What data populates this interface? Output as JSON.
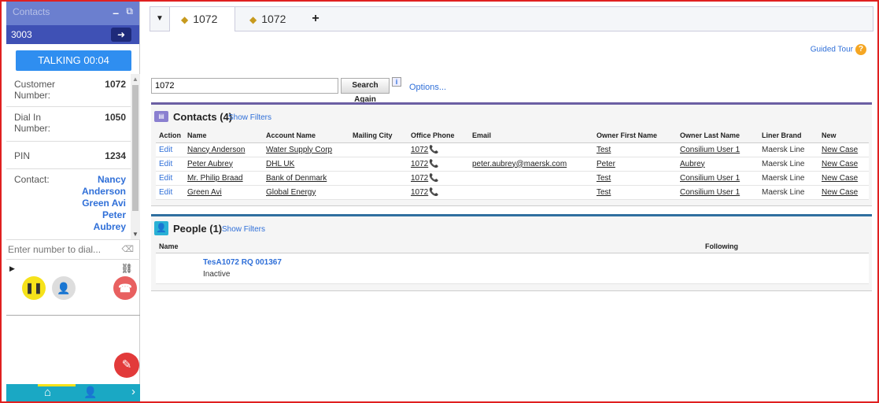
{
  "phone": {
    "title": "Contacts",
    "extension": "3003",
    "status": "TALKING 00:04",
    "info": [
      {
        "label": "Customer Number:",
        "value": "1072"
      },
      {
        "label": "Dial In Number:",
        "value": "1050"
      },
      {
        "label": "PIN",
        "value": "1234"
      }
    ],
    "contact_label": "Contact:",
    "contacts": [
      "Nancy",
      "Anderson",
      "Green Avi",
      "Peter",
      "Aubrey"
    ],
    "dial_placeholder": "Enter number to dial...",
    "colors": {
      "header": "#6b7fcf",
      "ext_bar": "#3f51b5",
      "talking": "#2f8ef0",
      "hold": "#f6e21a",
      "hangup": "#e86060",
      "edit": "#e23a3a",
      "bottom": "#1aa8c4"
    }
  },
  "tabs": [
    {
      "label": "1072",
      "active": true
    },
    {
      "label": "1072",
      "active": false
    }
  ],
  "guided_tour": "Guided Tour",
  "search": {
    "value": "1072",
    "button": "Search Again",
    "info": "i",
    "options": "Options..."
  },
  "contacts": {
    "title": "Contacts (4)",
    "show_filters": "Show Filters",
    "columns": [
      "Action",
      "Name",
      "Account Name",
      "Mailing City",
      "Office Phone",
      "Email",
      "Owner First Name",
      "Owner Last Name",
      "Liner Brand",
      "New"
    ],
    "rows": [
      {
        "action": "Edit",
        "name": "Nancy Anderson",
        "account": "Water Supply Corp",
        "city": "",
        "phone": "1072",
        "email": "",
        "owner_first": "Test",
        "owner_last": "Consilium User 1",
        "brand": "Maersk Line",
        "new": "New Case"
      },
      {
        "action": "Edit",
        "name": "Peter Aubrey",
        "account": "DHL UK",
        "city": "",
        "phone": "1072",
        "email": "peter.aubrey@maersk.com",
        "owner_first": "Peter",
        "owner_last": "Aubrey",
        "brand": "Maersk Line",
        "new": "New Case"
      },
      {
        "action": "Edit",
        "name": "Mr. Philip Braad",
        "account": "Bank of Denmark",
        "city": "",
        "phone": "1072",
        "email": "",
        "owner_first": "Test",
        "owner_last": "Consilium User 1",
        "brand": "Maersk Line",
        "new": "New Case"
      },
      {
        "action": "Edit",
        "name": "Green Avi",
        "account": "Global Energy",
        "city": "",
        "phone": "1072",
        "email": "",
        "owner_first": "Test",
        "owner_last": "Consilium User 1",
        "brand": "Maersk Line",
        "new": "New Case"
      }
    ]
  },
  "people": {
    "title": "People (1)",
    "show_filters": "Show Filters",
    "columns": [
      "Name",
      "Following"
    ],
    "person_name": "TesA1072 RQ 001367",
    "person_status": "Inactive"
  }
}
